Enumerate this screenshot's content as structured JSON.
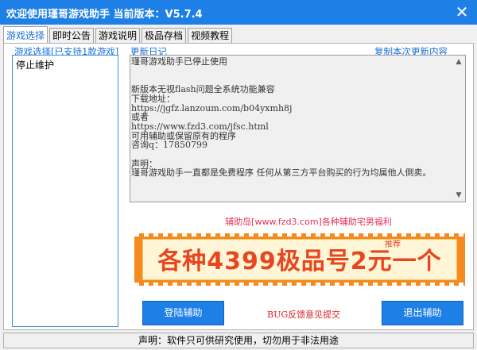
{
  "window": {
    "title": "欢迎使用瑾哥游戏助手  当前版本：V5.7.4",
    "close_icon": "✕"
  },
  "tabs": [
    {
      "label": "游戏选择",
      "active": true
    },
    {
      "label": "即时公告",
      "active": false
    },
    {
      "label": "游戏说明",
      "active": false
    },
    {
      "label": "极品存档",
      "active": false
    },
    {
      "label": "视频教程",
      "active": false
    }
  ],
  "games": {
    "label": "游戏选择[已支持1款游戏]",
    "items": [
      "停止维护"
    ]
  },
  "log": {
    "label": "更新日记",
    "copy_link": "复制本次更新内容",
    "text": "瑾哥游戏助手已停止使用\n\n\n新版本无视flash问题全系统功能兼容\n下载地址：\nhttps://jgfz.lanzoum.com/b04yxmh8j\n或者\nhttps://www.fzd3.com/jfsc.html\n可用辅助或保留原有的程序\n咨询q：17850799\n\n声明：\n瑾哥游戏助手一直都是免费程序 任何从第三方平台购买的行为均属他人倒卖。"
  },
  "promo": {
    "link_text": "辅助岛[www.fzd3.com]各种辅助宅男福利",
    "banner_text": "各种4399极品号2元一个",
    "banner_badge": "推荐"
  },
  "actions": {
    "login_label": "登陆辅助",
    "bug_label": "BUG反馈意见提交",
    "exit_label": "退出辅助"
  },
  "status_text": "声明：软件只可供研究使用，切勿用于非法用途",
  "colors": {
    "titlebar": "#1e7fe6",
    "accent_blue": "#1a6fd6",
    "promo_pink": "#e8305a",
    "banner_orange": "#f58b1e",
    "banner_text": "#e8461e",
    "bug_red": "#e02020"
  }
}
